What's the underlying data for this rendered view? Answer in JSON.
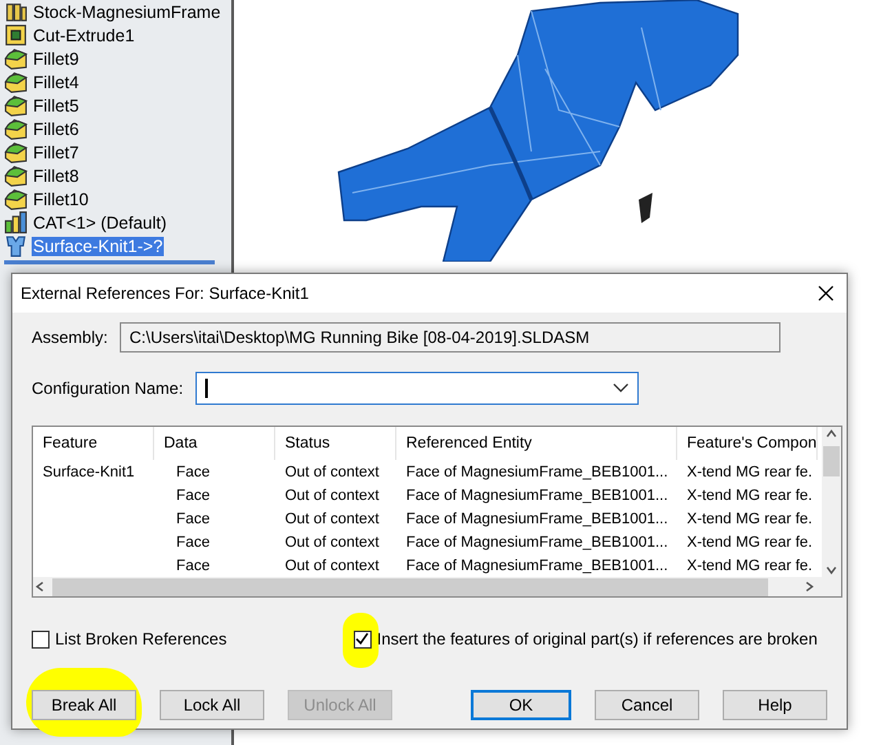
{
  "tree": {
    "items": [
      {
        "kind": "stock",
        "label": "Stock-MagnesiumFrame",
        "selected": false
      },
      {
        "kind": "cut",
        "label": "Cut-Extrude1",
        "selected": false
      },
      {
        "kind": "fillet",
        "label": "Fillet9",
        "selected": false
      },
      {
        "kind": "fillet",
        "label": "Fillet4",
        "selected": false
      },
      {
        "kind": "fillet",
        "label": "Fillet5",
        "selected": false
      },
      {
        "kind": "fillet",
        "label": "Fillet6",
        "selected": false
      },
      {
        "kind": "fillet",
        "label": "Fillet7",
        "selected": false
      },
      {
        "kind": "fillet",
        "label": "Fillet8",
        "selected": false
      },
      {
        "kind": "fillet",
        "label": "Fillet10",
        "selected": false
      },
      {
        "kind": "assembly",
        "label": "CAT<1> (Default)",
        "selected": false
      },
      {
        "kind": "knit",
        "label": "Surface-Knit1->?",
        "selected": true
      }
    ]
  },
  "dialog": {
    "title": "External References For: Surface-Knit1",
    "assembly": {
      "label": "Assembly:",
      "value": "C:\\Users\\itai\\Desktop\\MG Running Bike [08-04-2019].SLDASM"
    },
    "configuration": {
      "label": "Configuration Name:"
    },
    "table": {
      "columns": [
        "Feature",
        "Data",
        "Status",
        "Referenced Entity",
        "Feature's Compon"
      ],
      "rows": [
        [
          "Surface-Knit1",
          "Face",
          "Out of context",
          "Face of MagnesiumFrame_BEB1001...",
          "X-tend MG rear fe."
        ],
        [
          "",
          "Face",
          "Out of context",
          "Face of MagnesiumFrame_BEB1001...",
          "X-tend MG rear fe."
        ],
        [
          "",
          "Face",
          "Out of context",
          "Face of MagnesiumFrame_BEB1001...",
          "X-tend MG rear fe."
        ],
        [
          "",
          "Face",
          "Out of context",
          "Face of MagnesiumFrame_BEB1001...",
          "X-tend MG rear fe."
        ],
        [
          "",
          "Face",
          "Out of context",
          "Face of MagnesiumFrame_BEB1001...",
          "X-tend MG rear fe."
        ]
      ]
    },
    "options": [
      {
        "label": "List Broken References",
        "checked": false,
        "highlighted": false
      },
      {
        "label": "Insert the features of original part(s) if references are broken",
        "checked": true,
        "highlighted": true
      }
    ],
    "buttons": [
      {
        "label": "Break All",
        "disabled": false,
        "default": false,
        "highlighted": true
      },
      {
        "label": "Lock All",
        "disabled": false,
        "default": false,
        "highlighted": false
      },
      {
        "label": "Unlock All",
        "disabled": true,
        "default": false,
        "highlighted": false
      },
      {
        "label": "OK",
        "disabled": false,
        "default": true,
        "highlighted": false
      },
      {
        "label": "Cancel",
        "disabled": false,
        "default": false,
        "highlighted": false
      },
      {
        "label": "Help",
        "disabled": false,
        "default": false,
        "highlighted": false
      }
    ]
  }
}
